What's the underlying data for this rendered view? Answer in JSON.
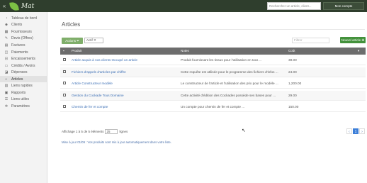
{
  "header": {
    "back_symbol": "«",
    "app_name": "Mat",
    "search_placeholder": "Rechercher un article, client...",
    "user_label": "Mon compte"
  },
  "sidebar": {
    "items": [
      {
        "label": "Tableau de bord",
        "icon": "dashboard-icon",
        "glyph": "◔",
        "active": false
      },
      {
        "label": "Clients",
        "icon": "users-icon",
        "glyph": "☻",
        "active": false
      },
      {
        "label": "Fournisseurs",
        "icon": "building-icon",
        "glyph": "▦",
        "active": false
      },
      {
        "label": "Devis (Offres)",
        "icon": "quote-icon",
        "glyph": "✎",
        "active": false
      },
      {
        "label": "Factures",
        "icon": "invoice-icon",
        "glyph": "▤",
        "active": false
      },
      {
        "label": "Paiements",
        "icon": "payment-icon",
        "glyph": "◫",
        "active": false
      },
      {
        "label": "Encaissements",
        "icon": "cash-icon",
        "glyph": "⊟",
        "active": false
      },
      {
        "label": "Crédits / Avoirs",
        "icon": "credit-icon",
        "glyph": "▭",
        "active": false
      },
      {
        "label": "Dépenses",
        "icon": "expense-icon",
        "glyph": "◪",
        "active": false
      },
      {
        "label": "Articles",
        "icon": "tag-icon",
        "glyph": "◐",
        "active": true
      },
      {
        "label": "Liens rapides",
        "icon": "link-icon",
        "glyph": "▥",
        "active": false
      },
      {
        "label": "Rapports",
        "icon": "report-icon",
        "glyph": "▣",
        "active": false
      },
      {
        "label": "Liens utiles",
        "icon": "list-icon",
        "glyph": "☰",
        "active": false
      },
      {
        "label": "Paramètres",
        "icon": "gear-icon",
        "glyph": "✲",
        "active": false
      }
    ]
  },
  "page": {
    "title": "Articles",
    "actions_btn": "Actions ⏷",
    "archive_btn": "Archivé ⏷",
    "active_filter": "Actif ✕",
    "filter_placeholder": "Filtrer",
    "add_btn": "Nouvel article ✚"
  },
  "table": {
    "columns": [
      "Produit",
      "Notes",
      "Coût"
    ],
    "rows": [
      {
        "product": "Article acquis à nos clients  Occupé un article",
        "notes": "Produit fournissant les tissus pour l'utilisation en tout ...",
        "price": "39.00"
      },
      {
        "product": "Fichiers d'appels d'articles par chiffre",
        "notes": "Cette requête est utilisée pour le programme des fichiers d'infos ...",
        "price": "24.00"
      },
      {
        "product": "Article Constructeur modèle",
        "notes": "Le constructeur de l'article et l'utilisation des prix pour le modèle ...",
        "price": "1,200.00"
      },
      {
        "product": "Gestion du Cockade Tous Domaine",
        "notes": "Cette activité d'édition des Cockades possède ses bases pour ...",
        "price": "29.00"
      },
      {
        "product": "Chemin de fer et compte",
        "notes": "Un compte pour chemin de fer et compte ...",
        "price": "150.00"
      }
    ]
  },
  "footer": {
    "showing_prefix": "Affichage 1 à 5 de 5 éléments",
    "per_page": "25",
    "per_page_suffix": "lignes",
    "note": "Mise à jour 01/09 : Vos produits sont mis à jour automatiquement dans votre liste.",
    "pager_prev": "‹",
    "pager_current": "1",
    "pager_next": "›"
  },
  "colors": {
    "topbar": "#2f3e2d",
    "accent_green": "#43913b",
    "link": "#3c6fb5",
    "table_header": "#6d6d6d",
    "pager_active": "#3d7fd8"
  }
}
